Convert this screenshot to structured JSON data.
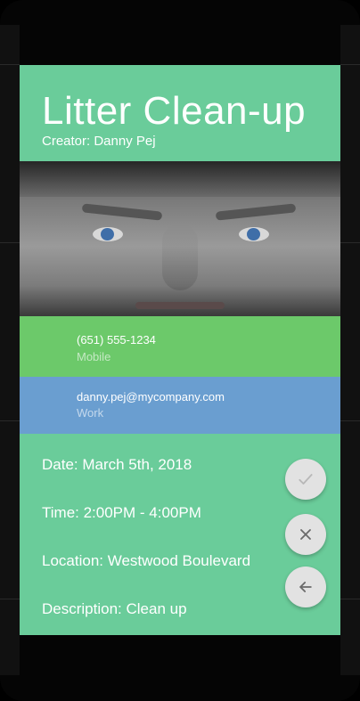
{
  "event": {
    "title": "Litter Clean-up",
    "creator": "Creator: Danny Pej"
  },
  "contact": {
    "phone": "(651) 555-1234",
    "phone_type": "Mobile",
    "email": "danny.pej@mycompany.com",
    "email_type": "Work"
  },
  "details": {
    "date": "Date: March 5th, 2018",
    "time": "Time: 2:00PM - 4:00PM",
    "location": "Location: Westwood Boulevard",
    "description": "Description: Clean up"
  },
  "actions": [
    {
      "icon": "check-icon"
    },
    {
      "icon": "close-icon"
    },
    {
      "icon": "arrow-left-icon"
    }
  ],
  "colors": {
    "header": "#6acc9a",
    "phone_row": "#6cc96a",
    "email_row": "#6a9ed0",
    "fab": "#e2e2e2"
  }
}
